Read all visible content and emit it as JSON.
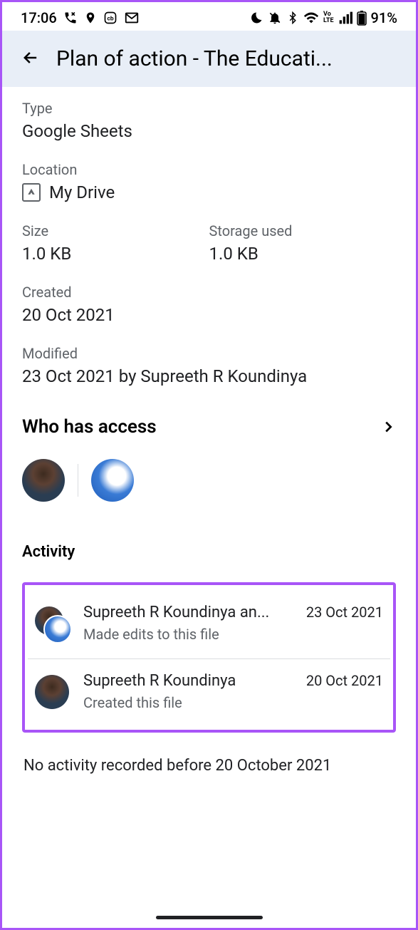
{
  "status": {
    "time": "17:06",
    "battery": "91%"
  },
  "header": {
    "title": "Plan of action - The Educati..."
  },
  "info": {
    "type_label": "Type",
    "type_value": "Google Sheets",
    "location_label": "Location",
    "location_value": "My Drive",
    "size_label": "Size",
    "size_value": "1.0 KB",
    "storage_label": "Storage used",
    "storage_value": "1.0 KB",
    "created_label": "Created",
    "created_value": "20 Oct 2021",
    "modified_label": "Modified",
    "modified_value": "23 Oct 2021 by Supreeth R Koundinya"
  },
  "access": {
    "title": "Who has access"
  },
  "activity": {
    "title": "Activity",
    "items": [
      {
        "name": "Supreeth R Koundinya an...",
        "date": "23 Oct 2021",
        "desc": "Made edits to this file"
      },
      {
        "name": "Supreeth R Koundinya",
        "date": "20 Oct 2021",
        "desc": "Created this file"
      }
    ],
    "footer": "No activity recorded before 20 October 2021"
  }
}
